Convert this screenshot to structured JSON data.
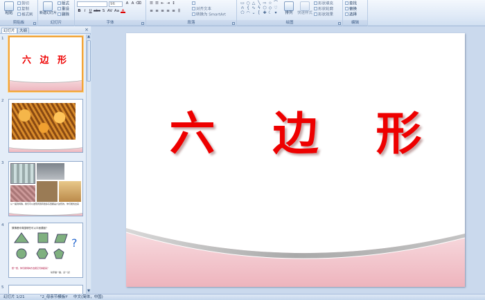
{
  "ribbon": {
    "clipboard": {
      "label": "剪贴板",
      "paste": "粘贴",
      "cut": "剪切",
      "copy": "复制",
      "format_painter": "格式刷"
    },
    "slides": {
      "label": "幻灯片",
      "new_slide": "新建幻灯片",
      "layout": "版式",
      "reset": "重设",
      "delete": "删除"
    },
    "font": {
      "label": "字体",
      "font_name": "",
      "font_size": "96",
      "bold": "B",
      "italic": "I",
      "underline": "U",
      "strike": "abc",
      "shadow": "S",
      "spacing": "AV",
      "case": "Aa",
      "color": "A"
    },
    "paragraph": {
      "label": "段落",
      "align_text": "对齐文本",
      "smartart": "转换为 SmartArt"
    },
    "drawing": {
      "label": "绘图",
      "arrange": "排列",
      "quick_styles": "快速样式",
      "shape_fill": "形状填充",
      "shape_outline": "形状轮廓",
      "shape_effects": "形状效果"
    },
    "editing": {
      "label": "编辑",
      "find": "查找",
      "replace": "替换",
      "select": "选择"
    }
  },
  "panel": {
    "tabs": [
      {
        "label": "幻灯片"
      },
      {
        "label": "大纲"
      }
    ],
    "close": "×",
    "thumbnails": [
      {
        "num": "1",
        "title": "六 边 形"
      },
      {
        "num": "2"
      },
      {
        "num": "3",
        "caption": "从一般到特殊，我们可以发现周围有很多东西都是六边形的，你们能找出来吗？"
      },
      {
        "num": "4",
        "heading": "猜猜看你周围哪些可以平面镶嵌？",
        "footer": "想一想，你们用何种方法把它们拼起来？",
        "footer2": "动手做一做，试一试！"
      },
      {
        "num": "5"
      }
    ]
  },
  "slide": {
    "title": "六 边 形"
  },
  "status": {
    "slide_indicator": "幻灯片 1/21",
    "theme": "\"2_母亲节模板\"",
    "language": "中文(简体，中国)"
  },
  "colors": {
    "title_red": "#ee0000",
    "accent_orange": "#f0a43a",
    "band_pink": "#eeb7bf"
  }
}
